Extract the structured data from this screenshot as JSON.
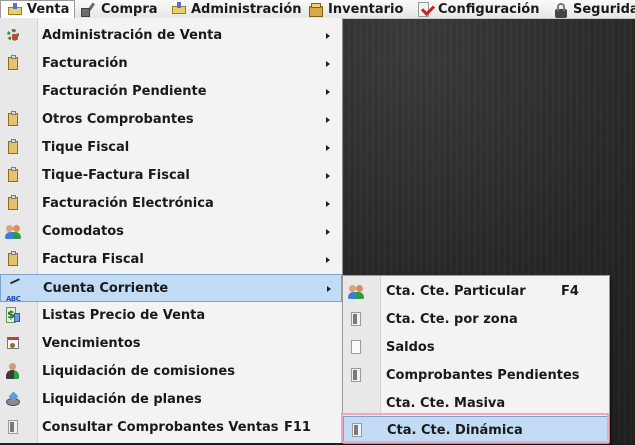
{
  "menubar": {
    "items": [
      {
        "label": "Venta",
        "icon": "sales-icon"
      },
      {
        "label": "Compra",
        "icon": "purchase-icon"
      },
      {
        "label": "Administración",
        "icon": "administration-icon"
      },
      {
        "label": "Inventario",
        "icon": "inventory-icon"
      },
      {
        "label": "Configuración",
        "icon": "settings-icon"
      },
      {
        "label": "Segurida",
        "icon": "security-icon"
      }
    ]
  },
  "venta_menu": {
    "items": [
      {
        "label": "Administración de Venta",
        "icon": "gear-icon",
        "submenu": true
      },
      {
        "label": "Facturación",
        "icon": "clipboard-icon",
        "submenu": true
      },
      {
        "label": "Facturación Pendiente",
        "icon": "",
        "submenu": true
      },
      {
        "label": "Otros Comprobantes",
        "icon": "clipboard-icon",
        "submenu": true
      },
      {
        "label": "Tique Fiscal",
        "icon": "clipboard-icon",
        "submenu": true
      },
      {
        "label": "Tique-Factura Fiscal",
        "icon": "clipboard-icon",
        "submenu": true
      },
      {
        "label": "Facturación Electrónica",
        "icon": "clipboard-icon",
        "submenu": true
      },
      {
        "label": "Comodatos",
        "icon": "people-icon",
        "submenu": true
      },
      {
        "label": "Factura Fiscal",
        "icon": "clipboard-icon",
        "submenu": true
      },
      {
        "label": "Cuenta Corriente",
        "icon": "abc-icon",
        "submenu": true,
        "highlighted": true
      },
      {
        "label": "Listas Precio de Venta",
        "icon": "price-list-icon",
        "submenu": false
      },
      {
        "label": "Vencimientos",
        "icon": "calendar-icon",
        "submenu": false
      },
      {
        "label": "Liquidación de comisiones",
        "icon": "person-icon",
        "submenu": false
      },
      {
        "label": "Liquidación de planes",
        "icon": "disk-icon",
        "submenu": false
      },
      {
        "label": "Consultar Comprobantes Ventas",
        "shortcut": "F11",
        "icon": "document-icon",
        "submenu": false
      }
    ]
  },
  "cuenta_corriente_submenu": {
    "items": [
      {
        "label": "Cta. Cte. Particular",
        "shortcut": "F4",
        "icon": "people-icon"
      },
      {
        "label": "Cta. Cte. por zona",
        "icon": "document-icon"
      },
      {
        "label": "Saldos",
        "icon": "blank-document-icon"
      },
      {
        "label": "Comprobantes Pendientes",
        "icon": "document-icon"
      },
      {
        "label": "Cta. Cte. Masiva",
        "icon": ""
      },
      {
        "label": "Cta. Cte. Dinámica",
        "icon": "document-icon",
        "highlighted": true
      }
    ]
  },
  "colors": {
    "highlight": "#c3dcf5",
    "highlight_border": "#7da2ce",
    "focus_ring": "#f0a6be",
    "menu_bg": "#f3f3f3",
    "desktop_bg": "#1e1e1e"
  }
}
